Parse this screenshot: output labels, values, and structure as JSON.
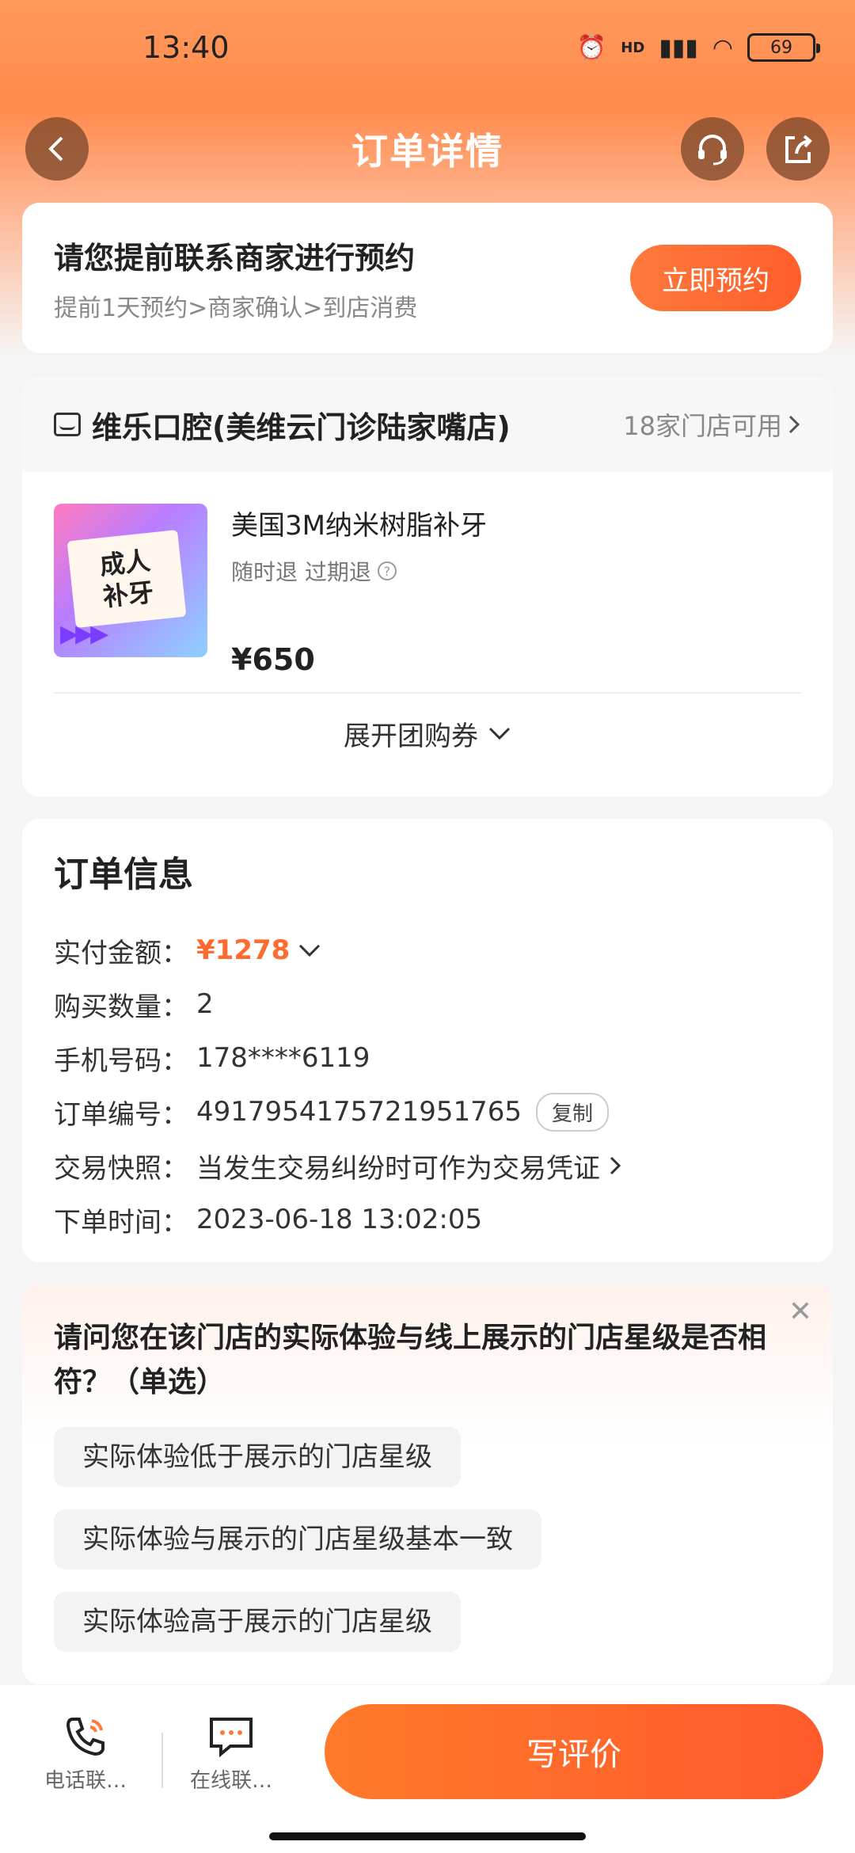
{
  "status_bar": {
    "time": "13:40",
    "icons": [
      "alarm-icon",
      "signal-icon",
      "wifi-icon"
    ],
    "network_label": "HD",
    "battery": "69"
  },
  "nav": {
    "title": "订单详情",
    "back_icon": "chevron-left-icon",
    "support_icon": "headset-icon",
    "share_icon": "share-icon"
  },
  "reservation": {
    "title": "请您提前联系商家进行预约",
    "subtitle": "提前1天预约>商家确认>到店消费",
    "button_label": "立即预约"
  },
  "store": {
    "name": "维乐口腔(美维云门诊陆家嘴店)",
    "available": "18家门店可用",
    "product": {
      "image_text_line1": "成人",
      "image_text_line2": "补牙",
      "name": "美国3M纳米树脂补牙",
      "tags": "随时退 过期退",
      "price": "¥650"
    },
    "expand_label": "展开团购券"
  },
  "order_info": {
    "title": "订单信息",
    "rows": [
      {
        "label": "实付金额：",
        "value": "¥1278"
      },
      {
        "label": "购买数量：",
        "value": "2"
      },
      {
        "label": "手机号码：",
        "value": "178****6119"
      },
      {
        "label": "订单编号：",
        "value": "4917954175721951765"
      },
      {
        "label": "交易快照：",
        "value": "当发生交易纠纷时可作为交易凭证"
      },
      {
        "label": "下单时间：",
        "value": "2023-06-18 13:02:05"
      }
    ],
    "copy_label": "复制"
  },
  "survey": {
    "question": "请问您在该门店的实际体验与线上展示的门店星级是否相符？（单选）",
    "options": [
      "实际体验低于展示的门店星级",
      "实际体验与展示的门店星级基本一致",
      "实际体验高于展示的门店星级"
    ]
  },
  "bottom_bar": {
    "phone_label": "电话联…",
    "chat_label": "在线联…",
    "review_label": "写评价"
  },
  "colors": {
    "accent": "#ff6a30",
    "header_gradient_top": "#ff9a5c"
  }
}
